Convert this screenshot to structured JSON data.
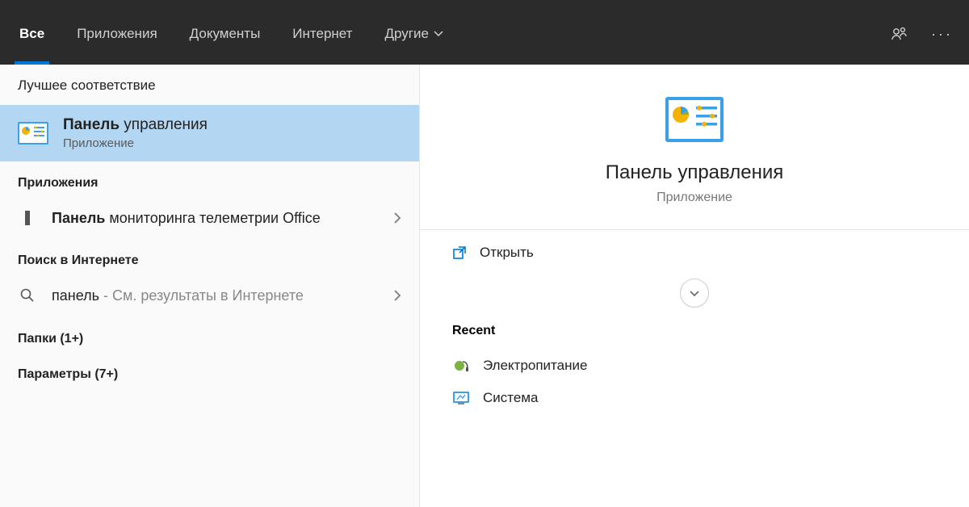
{
  "tabs": {
    "all": "Все",
    "apps": "Приложения",
    "docs": "Документы",
    "web": "Интернет",
    "more": "Другие"
  },
  "left": {
    "best_match_header": "Лучшее соответствие",
    "best_match": {
      "title_bold": "Панель",
      "title_rest": " управления",
      "subtitle": "Приложение"
    },
    "apps_header": "Приложения",
    "app_result": {
      "bold": "Панель",
      "rest": " мониторинга телеметрии Office"
    },
    "web_header": "Поиск в Интернете",
    "web_result": {
      "query": "панель",
      "suffix": " - См. результаты в Интернете"
    },
    "folders_label": "Папки (1+)",
    "settings_label": "Параметры (7+)"
  },
  "right": {
    "title": "Панель управления",
    "subtitle": "Приложение",
    "open_label": "Открыть",
    "recent_header": "Recent",
    "recent": {
      "power": "Электропитание",
      "system": "Система"
    }
  }
}
